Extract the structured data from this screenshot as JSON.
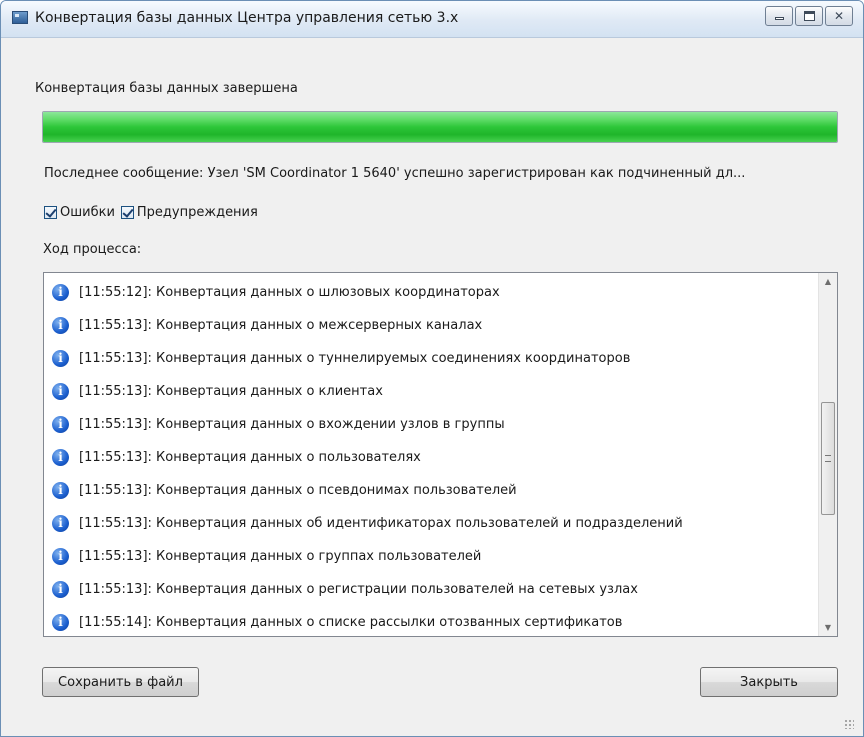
{
  "window": {
    "title": "Конвертация базы данных Центра управления сетью 3.x",
    "caption_buttons": {
      "minimize": "minimize",
      "maximize": "maximize",
      "close": "✕"
    }
  },
  "status": {
    "label": "Конвертация базы данных завершена",
    "progress_percent": 100,
    "progress_color": "#2dc639",
    "last_message": "Последнее сообщение: Узел 'SM Coordinator 1 5640' успешно зарегистрирован как подчиненный дл..."
  },
  "filters": {
    "errors": {
      "label": "Ошибки",
      "checked": true
    },
    "warnings": {
      "label": "Предупреждения",
      "checked": true
    }
  },
  "log": {
    "caption": "Ход процесса:",
    "icon": "info-icon",
    "entries": [
      "[11:55:12]: Конвертация данных о шлюзовых координаторах",
      "[11:55:13]: Конвертация данных о межсерверных каналах",
      "[11:55:13]: Конвертация данных о туннелируемых соединениях координаторов",
      "[11:55:13]: Конвертация данных о клиентах",
      "[11:55:13]: Конвертация данных о вхождении узлов в группы",
      "[11:55:13]: Конвертация данных о пользователях",
      "[11:55:13]: Конвертация данных о псевдонимах пользователей",
      "[11:55:13]: Конвертация данных об идентификаторах пользователей и подразделений",
      "[11:55:13]: Конвертация данных о группах пользователей",
      "[11:55:13]: Конвертация данных о регистрации пользователей на сетевых узлах",
      "[11:55:14]: Конвертация данных о списке рассылки отозванных сертификатов"
    ]
  },
  "buttons": {
    "save": "Сохранить в файл",
    "close": "Закрыть"
  }
}
